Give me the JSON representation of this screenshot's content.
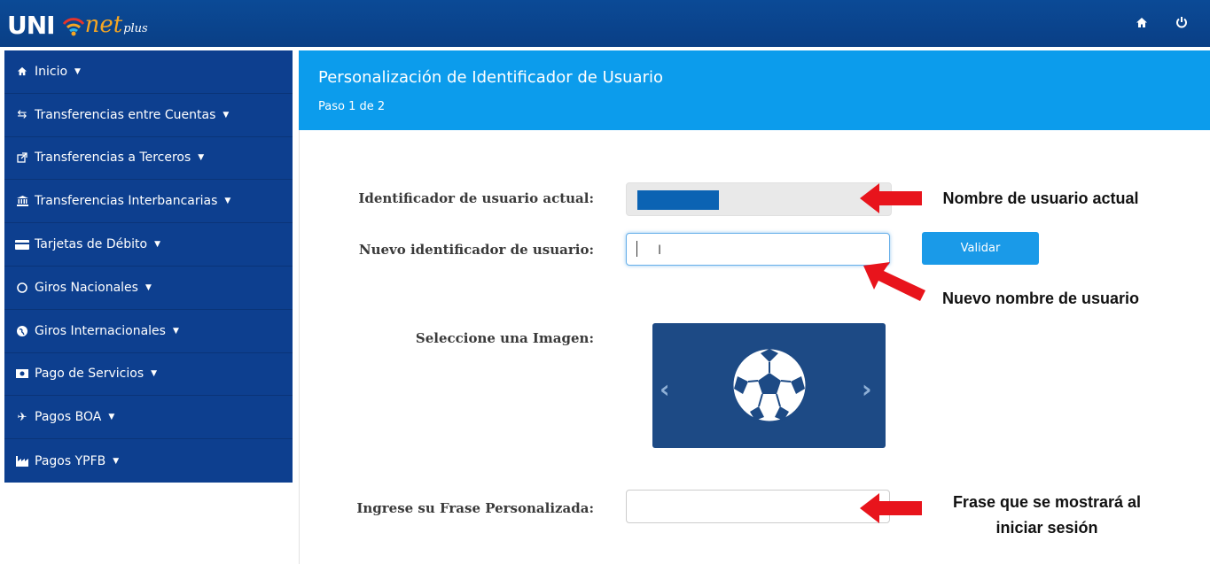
{
  "brand": {
    "uni": "UNI",
    "net": "net",
    "plus": "plus"
  },
  "topbar": {
    "home_icon": "home-icon",
    "power_icon": "power-icon"
  },
  "sidebar": {
    "items": [
      {
        "label": "Inicio",
        "icon": "home-icon"
      },
      {
        "label": "Transferencias entre Cuentas",
        "icon": "exchange-icon"
      },
      {
        "label": "Transferencias a Terceros",
        "icon": "external-link-icon"
      },
      {
        "label": "Transferencias Interbancarias",
        "icon": "bank-icon"
      },
      {
        "label": "Tarjetas de Débito",
        "icon": "credit-card-icon"
      },
      {
        "label": "Giros Nacionales",
        "icon": "circle-icon"
      },
      {
        "label": "Giros Internacionales",
        "icon": "globe-icon"
      },
      {
        "label": "Pago de Servicios",
        "icon": "money-icon"
      },
      {
        "label": "Pagos BOA",
        "icon": "plane-icon"
      },
      {
        "label": "Pagos YPFB",
        "icon": "industry-icon"
      }
    ]
  },
  "header": {
    "title": "Personalización de Identificador de Usuario",
    "step": "Paso 1 de 2"
  },
  "form": {
    "current_id_label": "Identificador de usuario actual:",
    "new_id_label": "Nuevo identificador de usuario:",
    "new_id_value": "",
    "validate_label": "Validar",
    "image_label": "Seleccione una Imagen:",
    "image_icon": "soccer-ball-icon",
    "phrase_label": "Ingrese su Frase Personalizada:",
    "phrase_value": ""
  },
  "annotations": {
    "current": "Nombre de usuario actual",
    "new": "Nuevo nombre de usuario",
    "phrase_line1": "Frase que se mostrará al",
    "phrase_line2": "iniciar sesión"
  },
  "colors": {
    "topbar": "#0b4a96",
    "sidebar": "#0d3f8f",
    "header": "#0c9cec",
    "button": "#1a9ae8",
    "arrow": "#e8141c"
  }
}
